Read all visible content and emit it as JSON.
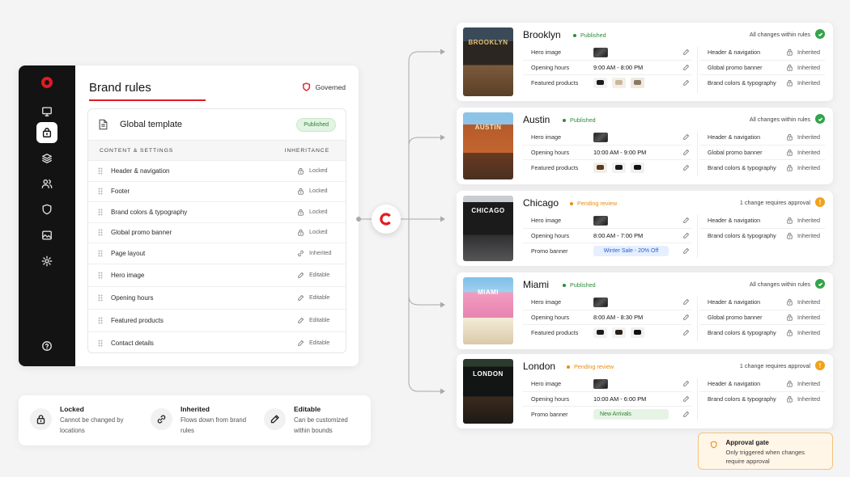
{
  "app": {
    "title": "Brand rules",
    "governed_label": "Governed",
    "template": {
      "title": "Global template",
      "status": "Published",
      "col_content": "CONTENT & SETTINGS",
      "col_inheritance": "INHERITANCE",
      "rules": [
        {
          "label": "Header & navigation",
          "status": "Locked",
          "icon": "lock-icon"
        },
        {
          "label": "Footer",
          "status": "Locked",
          "icon": "lock-icon"
        },
        {
          "label": "Brand colors & typography",
          "status": "Locked",
          "icon": "lock-icon"
        },
        {
          "label": "Global promo banner",
          "status": "Locked",
          "icon": "lock-icon"
        },
        {
          "label": "Page layout",
          "status": "Inherited",
          "icon": "link-icon"
        },
        {
          "label": "Hero image",
          "status": "Editable",
          "icon": "pencil-icon"
        },
        {
          "label": "Opening hours",
          "status": "Editable",
          "icon": "pencil-icon"
        },
        {
          "label": "Featured products",
          "status": "Editable",
          "icon": "pencil-icon"
        },
        {
          "label": "Contact details",
          "status": "Editable",
          "icon": "pencil-icon"
        }
      ]
    },
    "rail_icons": [
      "logo",
      "monitor-icon",
      "lock-bag-icon",
      "layers-icon",
      "users-icon",
      "shield-icon",
      "image-icon",
      "gear-icon",
      "help-icon"
    ]
  },
  "legend": [
    {
      "title": "Locked",
      "desc": "Cannot be changed by locations",
      "icon": "lock-icon"
    },
    {
      "title": "Inherited",
      "desc": "Flows down from brand rules",
      "icon": "link-icon"
    },
    {
      "title": "Editable",
      "desc": "Can be customized within bounds",
      "icon": "pencil-icon"
    }
  ],
  "locations": [
    {
      "name": "Brooklyn",
      "sign": "BROOKLYN",
      "status": "Published",
      "summary": "All changes within rules",
      "fields": {
        "hero": "Hero image",
        "hours_label": "Opening hours",
        "hours": "9:00 AM - 8:00 PM",
        "third_label": "Featured products"
      },
      "inherits": [
        {
          "label": "Header & navigation",
          "tag": "Inherited"
        },
        {
          "label": "Global promo banner",
          "tag": "Inherited"
        },
        {
          "label": "Brand colors & typography",
          "tag": "Inherited"
        }
      ]
    },
    {
      "name": "Austin",
      "sign": "AUSTIN",
      "status": "Published",
      "summary": "All changes within rules",
      "fields": {
        "hero": "Hero image",
        "hours_label": "Opening hours",
        "hours": "10:00 AM - 9:00 PM",
        "third_label": "Featured products"
      },
      "inherits": [
        {
          "label": "Header & navigation",
          "tag": "Inherited"
        },
        {
          "label": "Global promo banner",
          "tag": "Inherited"
        },
        {
          "label": "Brand colors & typography",
          "tag": "Inherited"
        }
      ]
    },
    {
      "name": "Chicago",
      "sign": "CHICAGO",
      "status": "Pending review",
      "summary": "1 change requires approval",
      "fields": {
        "hero": "Hero image",
        "hours_label": "Opening hours",
        "hours": "8:00 AM - 7:00 PM",
        "third_label": "Promo banner",
        "banner": "Winter Sale - 20% Off"
      },
      "inherits": [
        {
          "label": "Header & navigation",
          "tag": "Inherited"
        },
        {
          "label": "Brand colors & typography",
          "tag": "Inherited"
        }
      ]
    },
    {
      "name": "Miami",
      "sign": "MIAMI",
      "status": "Published",
      "summary": "All changes within rules",
      "fields": {
        "hero": "Hero image",
        "hours_label": "Opening hours",
        "hours": "8:00 AM - 8:30 PM",
        "third_label": "Featured products"
      },
      "inherits": [
        {
          "label": "Header & navigation",
          "tag": "Inherited"
        },
        {
          "label": "Global promo banner",
          "tag": "Inherited"
        },
        {
          "label": "Brand colors & typography",
          "tag": "Inherited"
        }
      ]
    },
    {
      "name": "London",
      "sign": "LONDON",
      "status": "Pending review",
      "summary": "1 change requires approval",
      "fields": {
        "hero": "Hero image",
        "hours_label": "Opening hours",
        "hours": "10:00 AM - 6:00 PM",
        "third_label": "Promo banner",
        "banner": "New Arrivals"
      },
      "inherits": [
        {
          "label": "Header & navigation",
          "tag": "Inherited"
        },
        {
          "label": "Brand colors & typography",
          "tag": "Inherited"
        }
      ]
    }
  ],
  "approval_gate": {
    "title": "Approval gate",
    "desc": "Only triggered when changes require approval"
  },
  "colors": {
    "accent": "#e01b24",
    "published": "#2e8b3a",
    "pending": "#e98d12",
    "rail": "#131313"
  }
}
